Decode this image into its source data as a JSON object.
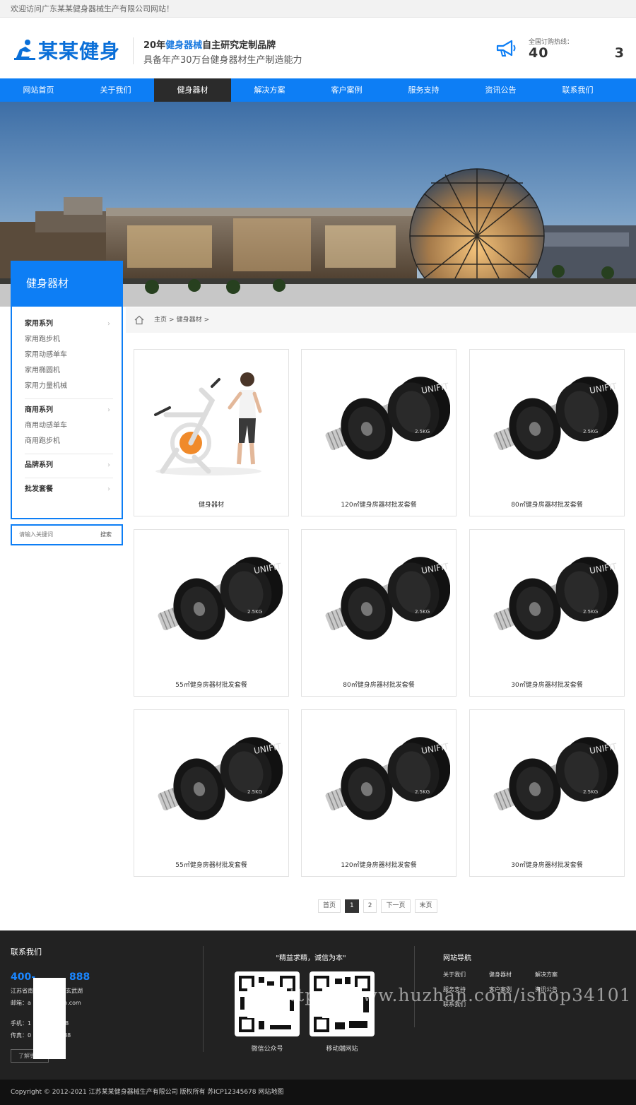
{
  "topbar": {
    "welcome": "欢迎访问广东某某健身器械生产有限公司网站！"
  },
  "header": {
    "logo_text": "某某健身",
    "slogan_pre": "20年",
    "slogan_hl": "健身器械",
    "slogan_post": "自主研究定制品牌",
    "slogan_line2": "具备年产30万台健身器材生产制造能力",
    "hotline_label": "全国订购热线：",
    "hotline_number": "40",
    "hotline_tail": "3",
    "colors": {
      "primary": "#0d7ef5",
      "dark": "#2b2b2b"
    }
  },
  "nav": [
    {
      "label": "网站首页"
    },
    {
      "label": "关于我们"
    },
    {
      "label": "健身器材",
      "active": true
    },
    {
      "label": "解决方案"
    },
    {
      "label": "客户案例"
    },
    {
      "label": "服务支持"
    },
    {
      "label": "资讯公告"
    },
    {
      "label": "联系我们"
    }
  ],
  "sidebar": {
    "title": "健身器材",
    "categories": [
      {
        "name": "家用系列",
        "items": [
          "家用跑步机",
          "家用动感单车",
          "家用椭圆机",
          "家用力量机械"
        ]
      },
      {
        "name": "商用系列",
        "items": [
          "商用动感单车",
          "商用跑步机"
        ]
      },
      {
        "name": "品牌系列",
        "items": []
      },
      {
        "name": "批发套餐",
        "items": []
      }
    ],
    "search_placeholder": "请输入关键词",
    "search_button": "搜索"
  },
  "breadcrumb": {
    "home": "主页",
    "sep": ">",
    "current": "健身器材"
  },
  "products": [
    {
      "title": "健身器材",
      "image": "exercise-bike-woman"
    },
    {
      "title": "120㎡健身房器材批发套餐",
      "image": "dumbbell"
    },
    {
      "title": "80㎡健身房器材批发套餐",
      "image": "dumbbell"
    },
    {
      "title": "55㎡健身房器材批发套餐",
      "image": "dumbbell"
    },
    {
      "title": "80㎡健身房器材批发套餐",
      "image": "dumbbell"
    },
    {
      "title": "30㎡健身房器材批发套餐",
      "image": "dumbbell"
    },
    {
      "title": "55㎡健身房器材批发套餐",
      "image": "dumbbell"
    },
    {
      "title": "120㎡健身房器材批发套餐",
      "image": "dumbbell"
    },
    {
      "title": "30㎡健身房器材批发套餐",
      "image": "dumbbell"
    }
  ],
  "pagination": {
    "first": "首页",
    "pages": [
      "1",
      "2"
    ],
    "current": "1",
    "next": "下一页",
    "last": "末页"
  },
  "footer": {
    "contact_title": "联系我们",
    "tel": "400-888-8888",
    "tel_visible": "400-",
    "tel_tail": "888",
    "address": "江苏省南京市玄武湖",
    "addr_visible": "江苏省南",
    "addr_tail": "玄武湖",
    "email_label": "邮箱：",
    "email_visible": "a",
    "email_tail": "in.com",
    "mobile_label": "手机：",
    "mobile_visible": "1",
    "mobile_tail": "8",
    "fax_label": "传真：",
    "fax_visible": "0",
    "fax_tail": "88",
    "more": "了解更多",
    "quote": "\"精益求精，诚信为本\"",
    "qr1": "微信公众号",
    "qr2": "移动端网站",
    "nav_title": "网站导航",
    "nav_links": [
      "关于我们",
      "健身器材",
      "解决方案",
      "服务支持",
      "客户案例",
      "资讯公告",
      "联系我们"
    ],
    "watermark": "https://www.huzhan.com/ishop34101",
    "copyright": "Copyright © 2012-2021 江苏某某健身器械生产有限公司 版权所有 苏ICP12345678 网站地图"
  }
}
